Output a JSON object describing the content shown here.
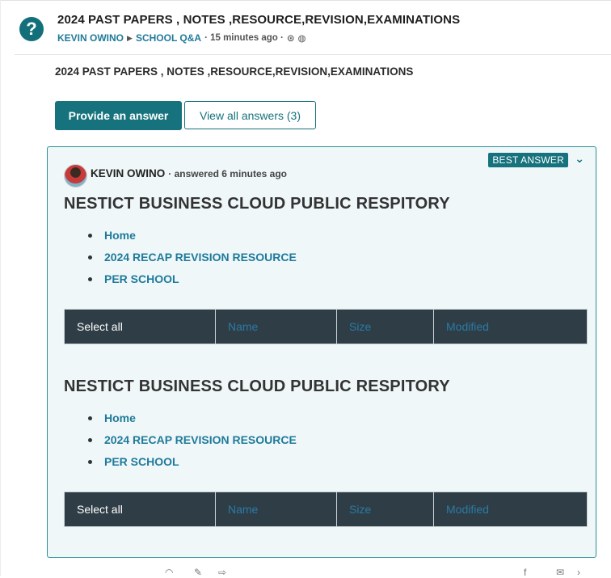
{
  "question": {
    "title": "2024 PAST PAPERS , NOTES ,RESOURCE,REVISION,EXAMINATIONS",
    "author": "KEVIN OWINO",
    "category": "SCHOOL Q&A",
    "time": "· 15 minutes ago ·",
    "body": "2024 PAST PAPERS , NOTES ,RESOURCE,REVISION,EXAMINATIONS"
  },
  "actions": {
    "provide_answer": "Provide an answer",
    "view_all": "View all answers (3)"
  },
  "answer": {
    "badge": "BEST ANSWER",
    "author": "KEVIN OWINO",
    "meta": "· answered 6 minutes ago",
    "sections": [
      {
        "title": "NESTICT BUSINESS CLOUD PUBLIC RESPITORY",
        "links": [
          "Home",
          "2024 RECAP REVISION RESOURCE",
          "PER SCHOOL"
        ],
        "table": {
          "select_all": "Select all",
          "columns": [
            "Name",
            "Size",
            "Modified"
          ]
        }
      },
      {
        "title": "NESTICT BUSINESS CLOUD PUBLIC RESPITORY",
        "links": [
          "Home",
          "2024 RECAP REVISION RESOURCE",
          "PER SCHOOL"
        ],
        "table": {
          "select_all": "Select all",
          "columns": [
            "Name",
            "Size",
            "Modified"
          ]
        }
      }
    ]
  },
  "colors": {
    "accent": "#16727c",
    "link": "#1f7a9a",
    "table_header": "#2f3e46",
    "answer_bg": "#eff7f9"
  },
  "icons": [
    "question-icon",
    "clock-icon",
    "globe-icon",
    "chevron-down-icon"
  ]
}
